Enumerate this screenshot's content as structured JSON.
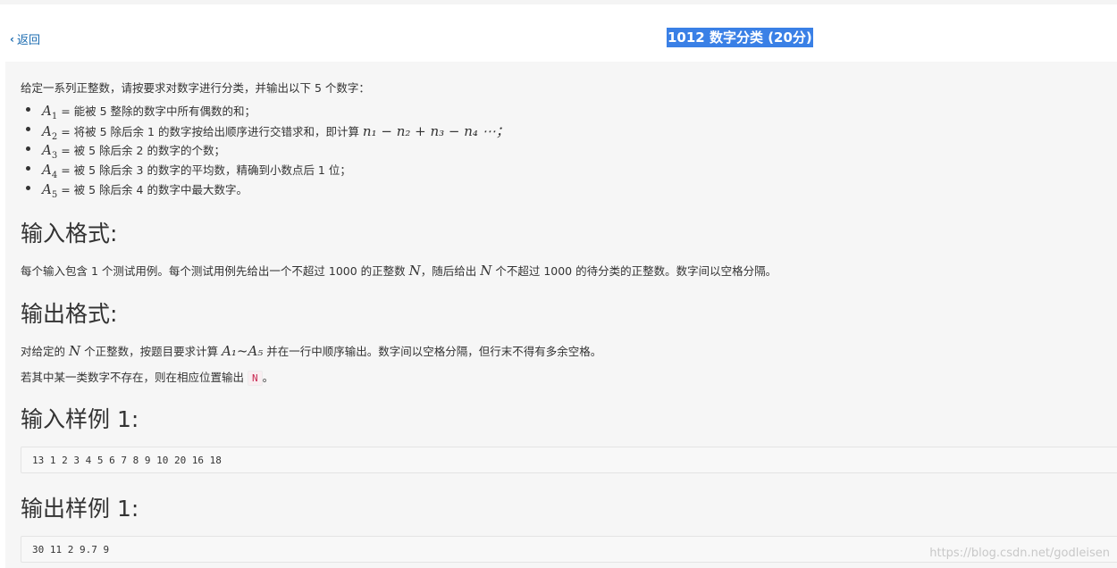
{
  "nav": {
    "back_label": "返回"
  },
  "problem": {
    "title": "1012 数字分类 (20分)",
    "intro": "给定一系列正整数，请按要求对数字进行分类，并输出以下 5 个数字：",
    "items": [
      {
        "var": "A",
        "sub": "1",
        "text": " = 能被 5 整除的数字中所有偶数的和；"
      },
      {
        "var": "A",
        "sub": "2",
        "text": " = 将被 5 除后余 1 的数字按给出顺序进行交错求和，即计算 ",
        "formula": "n₁ − n₂ + n₃ − n₄ ⋯；"
      },
      {
        "var": "A",
        "sub": "3",
        "text": " = 被 5 除后余 2 的数字的个数；"
      },
      {
        "var": "A",
        "sub": "4",
        "text": " = 被 5 除后余 3 的数字的平均数，精确到小数点后 1 位；"
      },
      {
        "var": "A",
        "sub": "5",
        "text": " = 被 5 除后余 4 的数字中最大数字。"
      }
    ],
    "input_heading": "输入格式:",
    "input_text_1": "每个输入包含 1 个测试用例。每个测试用例先给出一个不超过 1000 的正整数 ",
    "input_var_n": "N",
    "input_text_2": "，随后给出 ",
    "input_text_3": " 个不超过 1000 的待分类的正整数。数字间以空格分隔。",
    "output_heading": "输出格式:",
    "output_text_1": "对给定的 ",
    "output_text_2": " 个正整数，按题目要求计算 ",
    "output_range": "A₁~A₅",
    "output_text_3": " 并在一行中顺序输出。数字间以空格分隔，但行末不得有多余空格。",
    "output_text_4": "若其中某一类数字不存在，则在相应位置输出 ",
    "output_inline_code": "N",
    "output_text_5": "。",
    "sample_input_heading": "输入样例 1:",
    "sample_input": "13 1 2 3 4 5 6 7 8 9 10 20 16 18",
    "sample_output_heading": "输出样例 1:",
    "sample_output": "30 11 2 9.7 9"
  },
  "watermark": "https://blog.csdn.net/godleisen",
  "colors": {
    "title_bg": "#3a80e6",
    "link": "#1a6bb0",
    "panel_bg": "#f6f6f6"
  }
}
